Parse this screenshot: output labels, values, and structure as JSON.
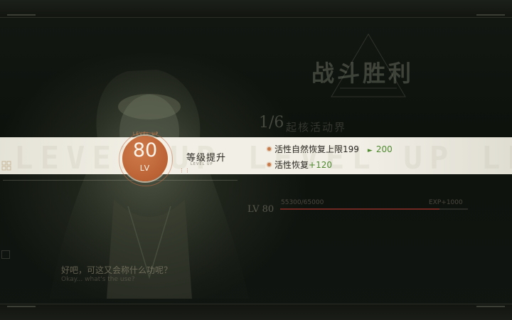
{
  "victory": {
    "title": "战斗胜利"
  },
  "mission": {
    "number": "1/6",
    "name": "起核活动界"
  },
  "level_up": {
    "level": "80",
    "lv_label": "LV",
    "ring_label": "LEVEL UP",
    "title": "等级提升",
    "subtitle": "LEVEL UP",
    "ghost_text": "LEVEL UP LEVEL UP LEVEL UP LEVEL UP"
  },
  "stats": [
    {
      "label": "活性自然恢复上限",
      "old_value": "199",
      "new_value": "200"
    },
    {
      "label": "活性恢复",
      "bonus": "+120"
    }
  ],
  "exp": {
    "level_label": "LV 80",
    "current": "55300/65000",
    "gain": "EXP+1000",
    "progress": 0.85
  },
  "dialogue": {
    "text": "好吧，可这又会称什么功呢？",
    "sub": "Okay... what's the use?"
  },
  "colors": {
    "accent_orange": "#bb6235",
    "stat_green": "#4f8a2e",
    "band": "#f2f0e6",
    "exp_fill": "#82281f"
  }
}
